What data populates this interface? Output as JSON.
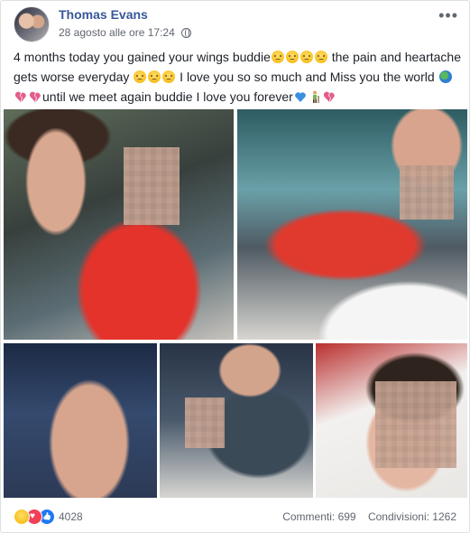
{
  "post": {
    "author": "Thomas Evans",
    "timestamp": "28 agosto alle ore 17:24",
    "more_glyph": "•••",
    "text_parts": {
      "p1": "4 months today you gained your wings buddie",
      "p2": " the pain and heartache gets worse everyday ",
      "p3": " I love you so so much and Miss you the world ",
      "p4": "until we meet again buddie I love you forever"
    }
  },
  "reactions": {
    "icons": [
      "sad",
      "love",
      "like"
    ],
    "count": "4028"
  },
  "stats": {
    "comments": "Commenti: 699",
    "shares": "Condivisioni: 1262"
  },
  "colors": {
    "author_link": "#385898",
    "meta_gray": "#616770",
    "love": "#f33e58",
    "like": "#2078f4"
  }
}
